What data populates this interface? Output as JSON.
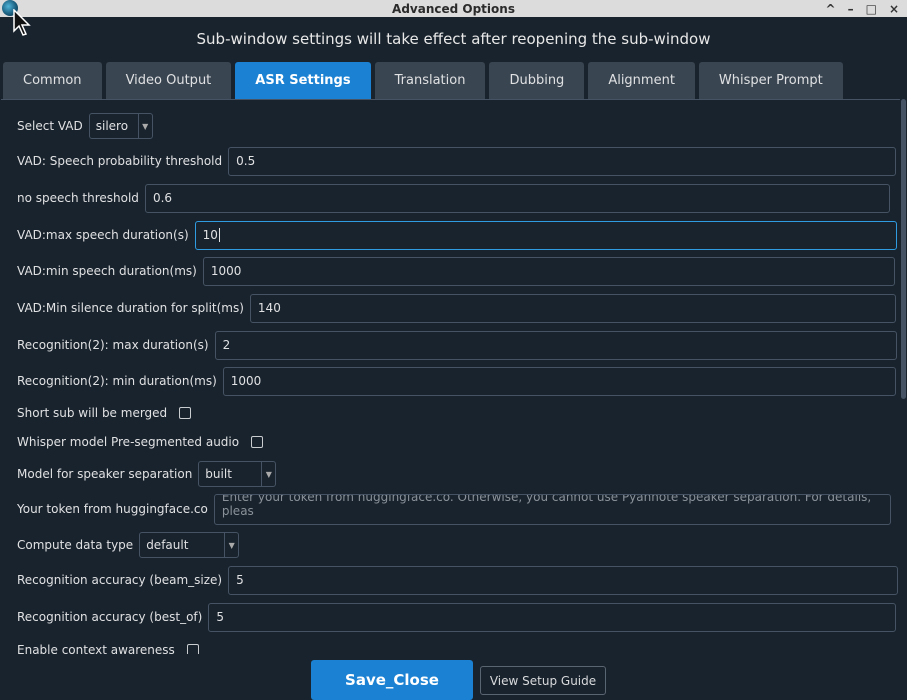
{
  "window": {
    "title": "Advanced Options",
    "controls": {
      "minimize": "^",
      "restore": "–",
      "maximize": "□",
      "close": "×"
    }
  },
  "notice": "Sub-window settings will take effect after reopening the sub-window",
  "tabs": [
    {
      "label": "Common"
    },
    {
      "label": "Video Output"
    },
    {
      "label": "ASR Settings"
    },
    {
      "label": "Translation"
    },
    {
      "label": "Dubbing"
    },
    {
      "label": "Alignment"
    },
    {
      "label": "Whisper Prompt"
    }
  ],
  "asr": {
    "select_vad": {
      "label": "Select VAD",
      "value": "silero"
    },
    "speech_prob": {
      "label": "VAD: Speech probability threshold",
      "value": "0.5"
    },
    "no_speech": {
      "label": "no speech threshold",
      "value": "0.6"
    },
    "max_speech": {
      "label": "VAD:max speech duration(s)",
      "value": "10"
    },
    "min_speech": {
      "label": "VAD:min speech duration(ms)",
      "value": "1000"
    },
    "min_silence": {
      "label": "VAD:Min silence duration for split(ms)",
      "value": "140"
    },
    "rec2_max": {
      "label": "Recognition(2): max duration(s)",
      "value": "2"
    },
    "rec2_min": {
      "label": "Recognition(2): min duration(ms)",
      "value": "1000"
    },
    "short_merge": {
      "label": "Short sub will be merged"
    },
    "presegment": {
      "label": "Whisper model Pre-segmented audio"
    },
    "speaker_model": {
      "label": "Model for speaker separation",
      "value": "built"
    },
    "hf_token": {
      "label": "Your token from huggingface.co",
      "placeholder": "Enter your token from huggingface.co. Otherwise, you cannot use Pyannote speaker separation. For details, pleas"
    },
    "compute_type": {
      "label": "Compute data type",
      "value": "default"
    },
    "beam_size": {
      "label": "Recognition accuracy (beam_size)",
      "value": "5"
    },
    "best_of": {
      "label": "Recognition accuracy (best_of)",
      "value": "5"
    },
    "context": {
      "label": "Enable context awareness"
    }
  },
  "buttons": {
    "save": "Save_Close",
    "guide": "View Setup Guide"
  }
}
